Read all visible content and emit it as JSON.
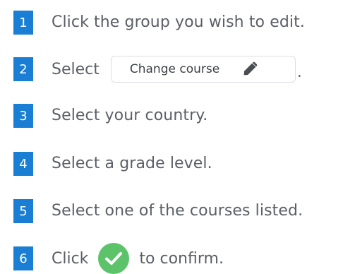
{
  "steps": [
    {
      "number": "1",
      "text": "Click the group you wish to edit."
    },
    {
      "number": "2",
      "text_before": "Select",
      "button_label": "Change course",
      "text_after": "."
    },
    {
      "number": "3",
      "text": "Select your country."
    },
    {
      "number": "4",
      "text": "Select a grade level."
    },
    {
      "number": "5",
      "text": "Select one of the courses listed."
    },
    {
      "number": "6",
      "text_before": "Click",
      "text_after": "to confirm."
    }
  ],
  "icons": {
    "pencil": "pencil-icon",
    "confirm": "checkmark-icon"
  },
  "colors": {
    "step_badge": "#1a7fd4",
    "confirm_button": "#5cc36a",
    "text": "#5b5f66"
  }
}
